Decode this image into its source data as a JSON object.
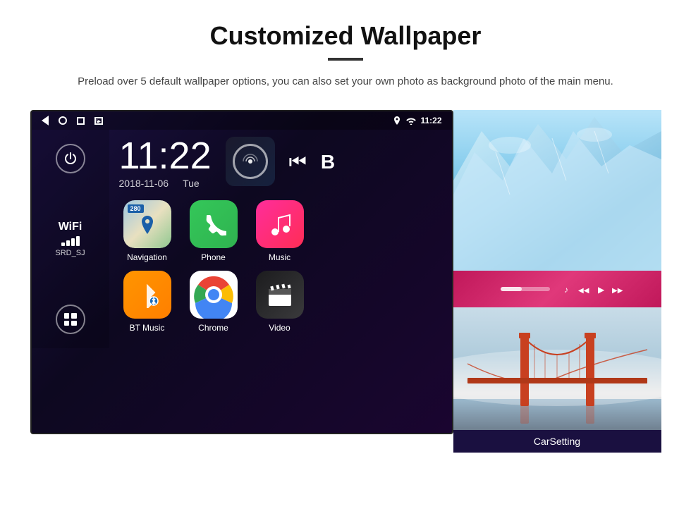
{
  "header": {
    "title": "Customized Wallpaper",
    "description": "Preload over 5 default wallpaper options, you can also set your own photo as background photo of the main menu."
  },
  "android_screen": {
    "status_bar": {
      "time": "11:22",
      "wifi_icon": "wifi-icon",
      "signal_icon": "signal-icon"
    },
    "clock": {
      "time": "11:22",
      "date": "2018-11-06",
      "day": "Tue"
    },
    "wifi": {
      "label": "WiFi",
      "ssid": "SRD_SJ"
    },
    "apps": [
      {
        "id": "navigation",
        "label": "Navigation"
      },
      {
        "id": "phone",
        "label": "Phone"
      },
      {
        "id": "music",
        "label": "Music"
      },
      {
        "id": "bt-music",
        "label": "BT Music"
      },
      {
        "id": "chrome",
        "label": "Chrome"
      },
      {
        "id": "video",
        "label": "Video"
      }
    ],
    "nav_badge": "280"
  },
  "wallpapers": [
    {
      "id": "ice",
      "alt": "Ice/Glacier wallpaper"
    },
    {
      "id": "music-player",
      "alt": "Music player screen"
    },
    {
      "id": "bridge",
      "alt": "Golden Gate Bridge wallpaper"
    }
  ],
  "carsetting": {
    "label": "CarSetting"
  }
}
